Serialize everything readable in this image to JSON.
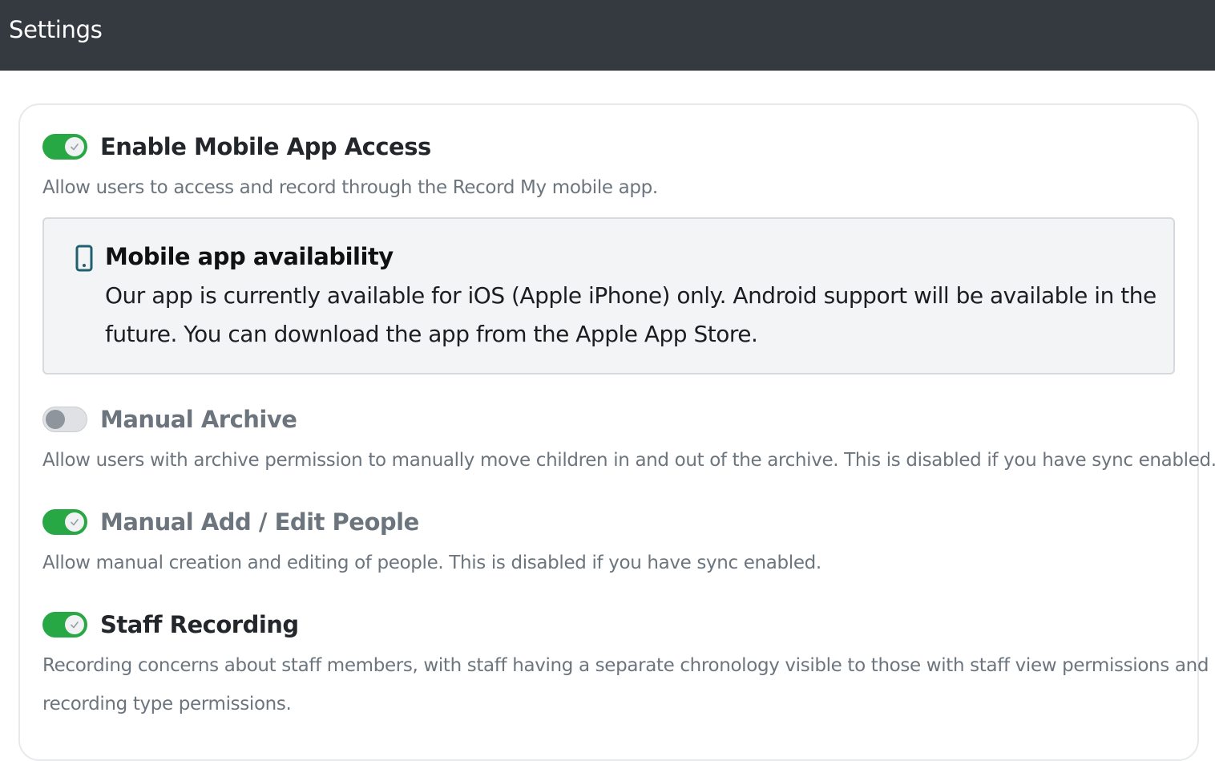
{
  "header": {
    "title": "Settings"
  },
  "settings": [
    {
      "title": "Enable Mobile App Access",
      "enabled": true,
      "description_lines": [
        "Allow users to access and record through the Record My mobile app."
      ]
    },
    {
      "title": "Manual Archive",
      "enabled": false,
      "description_lines": [
        "Allow users with archive permission to manually move children in and out of the archive. This is disabled if you have sync enabled."
      ]
    },
    {
      "title": "Manual Add / Edit People",
      "enabled": true,
      "description_lines": [
        "Allow manual creation and editing of people. This is disabled if you have sync enabled."
      ]
    },
    {
      "title": "Staff Recording",
      "enabled": true,
      "description_lines": [
        "Recording concerns about staff members, with staff having a separate chronology visible to those with staff view permissions and",
        "recording type permissions."
      ]
    }
  ],
  "info_box": {
    "icon": "mobile-phone-icon",
    "title": "Mobile app availability",
    "lines": [
      "Our app is currently available for iOS (Apple iPhone) only. Android support will be available in the",
      "future. You can download the app from the Apple App Store."
    ]
  },
  "colors": {
    "header_bg": "#343a40",
    "toggle_on": "#28a745",
    "toggle_off": "#dfe1e4",
    "muted_text": "#6c757d",
    "info_icon": "#1f5f6e"
  }
}
